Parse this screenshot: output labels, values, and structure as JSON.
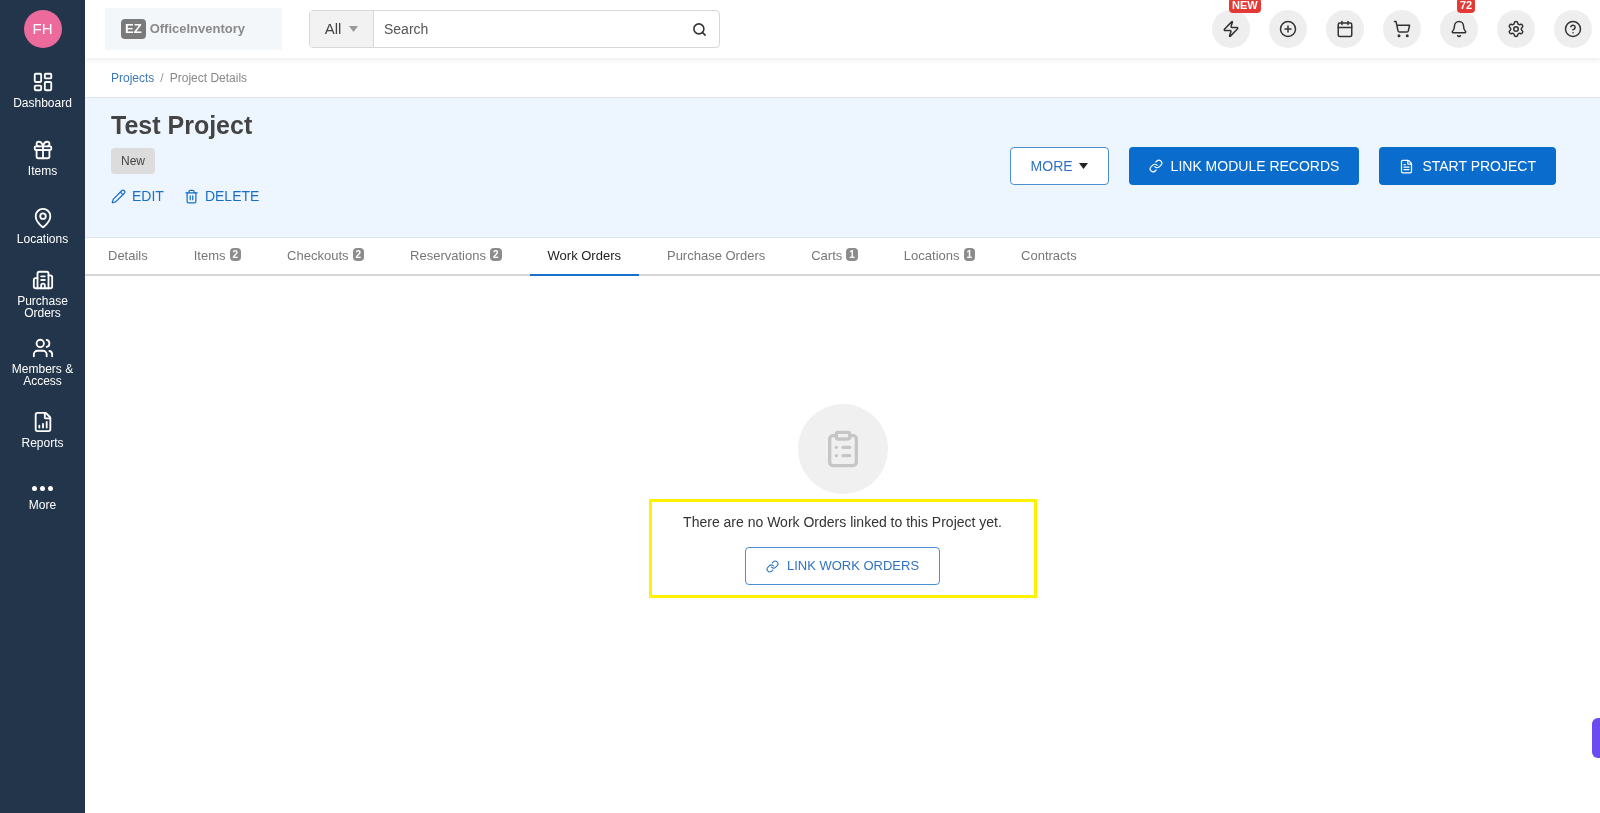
{
  "sidebar": {
    "avatar": "FH",
    "items": [
      {
        "kind": "dashboard",
        "label": "Dashboard"
      },
      {
        "kind": "items",
        "label": "Items"
      },
      {
        "kind": "locations",
        "label": "Locations"
      },
      {
        "kind": "purchase",
        "label": "Purchase Orders"
      },
      {
        "kind": "members",
        "label": "Members & Access"
      },
      {
        "kind": "reports",
        "label": "Reports"
      },
      {
        "kind": "more",
        "label": "More"
      }
    ]
  },
  "header": {
    "logo_mark": "EZ",
    "logo_text": "OfficeInventory",
    "search": {
      "scope": "All",
      "placeholder": "Search"
    },
    "actions": [
      {
        "kind": "bolt",
        "badge": "NEW"
      },
      {
        "kind": "add"
      },
      {
        "kind": "calendar"
      },
      {
        "kind": "cart"
      },
      {
        "kind": "bell",
        "badge": "72"
      },
      {
        "kind": "settings"
      },
      {
        "kind": "help"
      }
    ]
  },
  "breadcrumb": [
    "Projects",
    "Project Details"
  ],
  "breadcrumb_separator": "/",
  "project": {
    "title": "Test Project",
    "status": "New",
    "links": [
      {
        "kind": "edit",
        "label": "EDIT"
      },
      {
        "kind": "delete",
        "label": "DELETE"
      }
    ],
    "buttons": [
      {
        "kind": "more",
        "label": "MORE"
      },
      {
        "kind": "link",
        "label": "LINK MODULE RECORDS"
      },
      {
        "kind": "start",
        "label": "START PROJECT"
      }
    ]
  },
  "tabs": [
    {
      "label": "Details",
      "selected": false
    },
    {
      "label": "Items",
      "count": "2",
      "selected": false
    },
    {
      "label": "Checkouts",
      "count": "2",
      "selected": false
    },
    {
      "label": "Reservations",
      "count": "2",
      "selected": false
    },
    {
      "label": "Work Orders",
      "selected": true
    },
    {
      "label": "Purchase Orders",
      "selected": false
    },
    {
      "label": "Carts",
      "count": "1",
      "selected": false
    },
    {
      "label": "Locations",
      "count": "1",
      "selected": false
    },
    {
      "label": "Contracts",
      "selected": false
    }
  ],
  "empty_state": {
    "message": "There are no Work Orders linked to this Project yet.",
    "button": "LINK WORK ORDERS"
  }
}
